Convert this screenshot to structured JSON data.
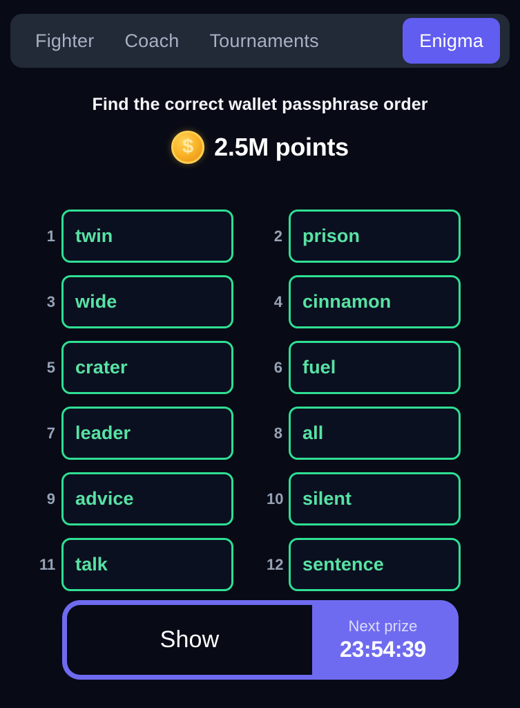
{
  "nav": {
    "tabs": [
      {
        "label": "Fighter",
        "active": false
      },
      {
        "label": "Coach",
        "active": false
      },
      {
        "label": "Tournaments",
        "active": false
      },
      {
        "label": "Enigma",
        "active": true
      }
    ]
  },
  "header": {
    "title": "Find the correct wallet passphrase order",
    "coin_icon": "gold-coin-dollar-icon",
    "coin_symbol": "$",
    "points": "2.5M points"
  },
  "puzzle": {
    "words": [
      {
        "index": "1",
        "word": "twin"
      },
      {
        "index": "2",
        "word": "prison"
      },
      {
        "index": "3",
        "word": "wide"
      },
      {
        "index": "4",
        "word": "cinnamon"
      },
      {
        "index": "5",
        "word": "crater"
      },
      {
        "index": "6",
        "word": "fuel"
      },
      {
        "index": "7",
        "word": "leader"
      },
      {
        "index": "8",
        "word": "all"
      },
      {
        "index": "9",
        "word": "advice"
      },
      {
        "index": "10",
        "word": "silent"
      },
      {
        "index": "11",
        "word": "talk"
      },
      {
        "index": "12",
        "word": "sentence"
      }
    ]
  },
  "footer": {
    "show_label": "Show",
    "prize_label": "Next prize",
    "prize_timer": "23:54:39"
  },
  "colors": {
    "page_background": "#080B16",
    "nav_background": "#222937",
    "accent_purple": "#615DF0",
    "bar_purple": "#6F6BF0",
    "word_border_green": "#2FDF93",
    "word_text_green": "#58E2A4",
    "index_gray": "#97A2B5",
    "coin_gold": "#FAB428"
  }
}
